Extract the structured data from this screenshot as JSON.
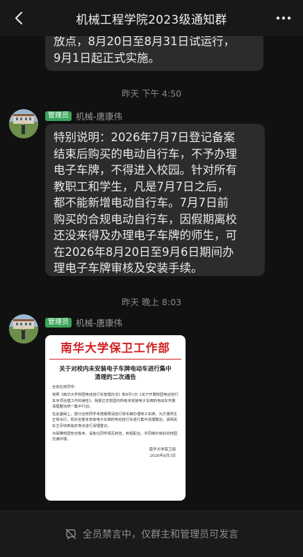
{
  "header": {
    "title": "机械工程学院2023级通知群"
  },
  "messages": {
    "prev_bubble": {
      "lines": [
        "放点，8月20日至8月31日试运行，",
        "9月1日起正式实施。"
      ]
    },
    "time1": "昨天 下午 4:50",
    "msg1": {
      "badge": "管理员",
      "sender": "机械-唐康伟",
      "lines": [
        "特别说明：2026年7月7日登记备案",
        "结束后购买的电动自行车，不予办理",
        "电子车牌，不得进入校园。针对所有",
        "教职工和学生，凡是7月7日之后，",
        "都不能新增电动自行车。7月7日前",
        "购买的合规电动自行车，因假期离校",
        "还没来得及办理电子车牌的师生，可",
        "在2026年8月20日至9月6日期间办",
        "理电子车牌审核及安装手续。"
      ]
    },
    "time2": "昨天 晚上 8:03",
    "msg2": {
      "badge": "管理员",
      "sender": "机械-唐康伟",
      "doc": {
        "header": "南华大学保卫工作部",
        "title_line1": "关于对校内未安装电子车牌电动车进行集中",
        "title_line2": "清理的二次通告",
        "greeting": "全体在校同学：",
        "para1": "依照《南华大学校园电动自行车管理办法》和8月1日《关于开展校园电动自行车专项治理工作的通告》，我部正式校园内所有未安装电子车牌的电动车开展清理整治统一集中行动。",
        "para2": "在此基础上，部分全校同学未按期限请自行将车辆办理电子车牌，为方便师生正常出行，现对全部未安装电子车牌的电动自行车进行集中清理整治，请相关车主尽快到指定地点进行清理登记。",
        "para3": "为保障校园安全秩序，请各位同学相互转告，积极配合，共同维护良好的校园交通环境。",
        "signature": "南华大学保卫部",
        "date": "2026年8月3日"
      }
    }
  },
  "footer": {
    "text": "全员禁言中，仅群主和管理员可发言"
  }
}
